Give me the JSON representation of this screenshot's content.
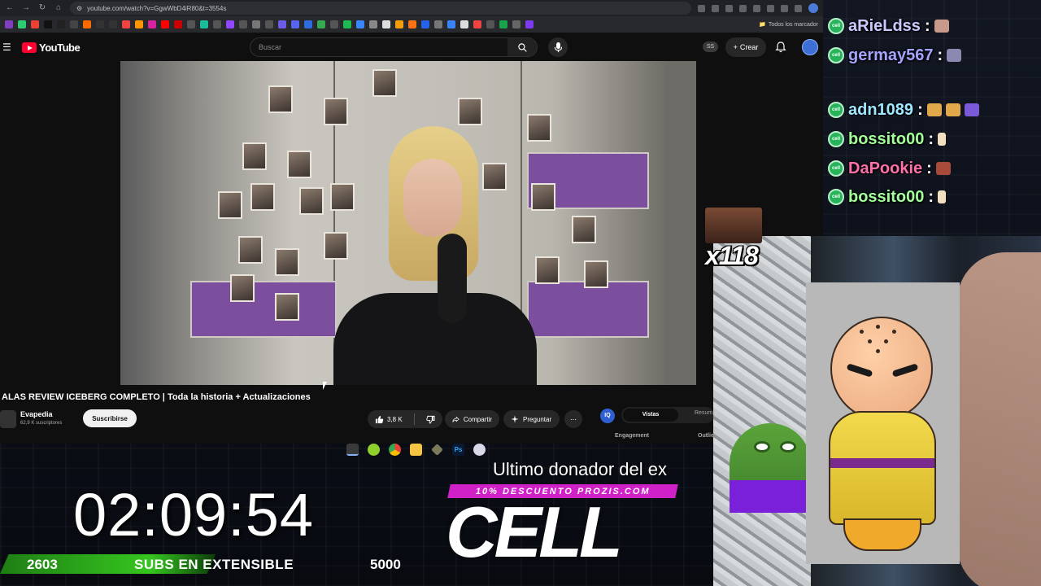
{
  "browser": {
    "url": "youtube.com/watch?v=GgwWbD4iR80&t=3554s",
    "all_bookmarks": "Todos los marcador"
  },
  "youtube": {
    "logo_text": "YouTube",
    "search_placeholder": "Buscar",
    "ss_label": "SS",
    "create_label": "Crear",
    "video_title": "ALAS REVIEW ICEBERG COMPLETO | Toda la historia + Actualizaciones",
    "channel_name": "Evapedia",
    "channel_subs": "62,9 K suscriptores",
    "subscribe_label": "Suscribirse",
    "like_count": "3,8 K",
    "share_label": "Compartir",
    "ask_label": "Preguntar"
  },
  "side_panel": {
    "tab_active": "Vistas",
    "tab_2": "Resum",
    "metric_1": "Engagement",
    "metric_2": "Outlie"
  },
  "chat": {
    "badge_text": "cell",
    "messages": [
      {
        "user": "aRieLdss",
        "color": "#c9c9ff",
        "emote_color": "#c89a8a"
      },
      {
        "user": "germay567",
        "color": "#a7a4ff",
        "emote_color": "#8a8ab0"
      },
      {
        "user": "adn1089",
        "color": "#9fe6ff",
        "emote_color": "#e0a84a"
      },
      {
        "user": "bossito00",
        "color": "#a3ff9a",
        "emote_color": "#f0e0c0"
      },
      {
        "user": "DaPookie",
        "color": "#ff6fa8",
        "emote_color": "#a84a3a"
      },
      {
        "user": "bossito00",
        "color": "#a3ff9a",
        "emote_color": "#f0e0c0"
      }
    ]
  },
  "overlay": {
    "combo_text": "x118",
    "donor_label": "Ultimo donador del ex",
    "promo_text": "10% DESCUENTO PROZIS.COM",
    "donor_name": "CELL",
    "timer": "02:09:54",
    "subs_current": "2603",
    "subs_label": "SUBS EN EXTENSIBLE",
    "subs_goal": "5000",
    "subs_progress": 0.52
  }
}
